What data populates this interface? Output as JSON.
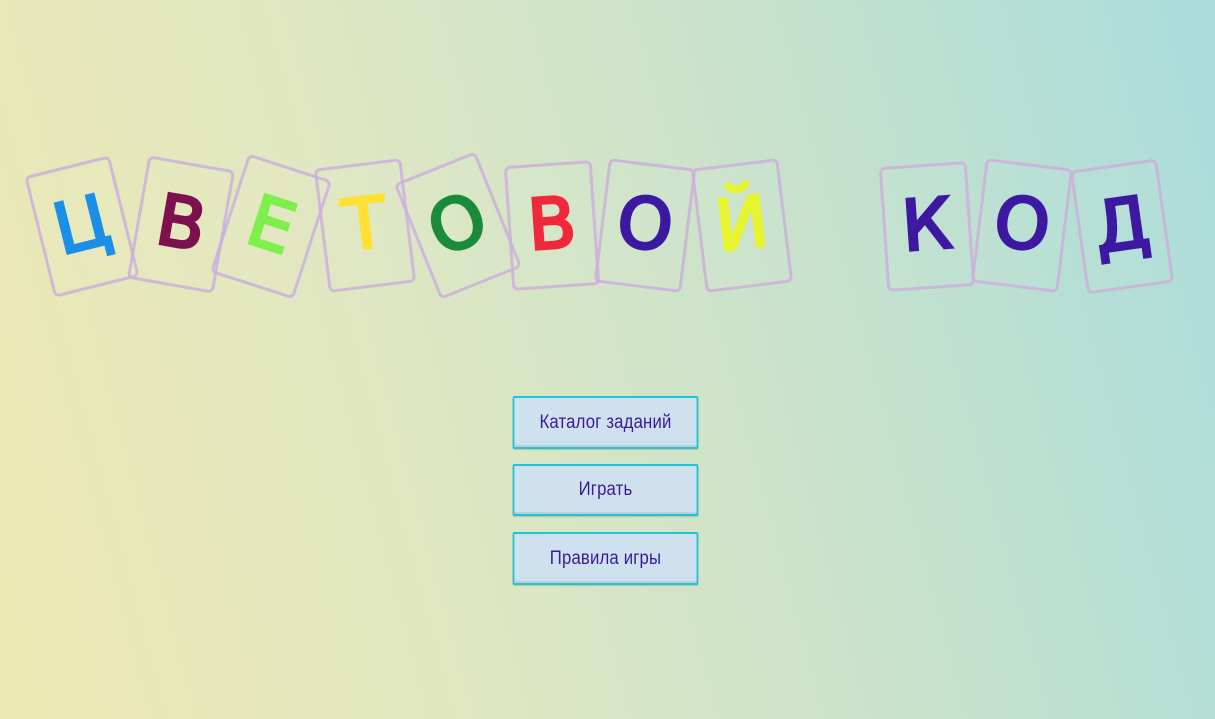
{
  "title": {
    "letters": [
      {
        "char": "ц",
        "color": "#1b8fe8"
      },
      {
        "char": "в",
        "color": "#7d1150"
      },
      {
        "char": "е",
        "color": "#7ff04b"
      },
      {
        "char": "т",
        "color": "#ffe035"
      },
      {
        "char": "о",
        "color": "#1a8a3b"
      },
      {
        "char": "в",
        "color": "#f0283c"
      },
      {
        "char": "о",
        "color": "#3d18a0"
      },
      {
        "char": "й",
        "color": "#e6f52e"
      },
      {
        "char": "к",
        "color": "#3d18a0"
      },
      {
        "char": "о",
        "color": "#3d18a0"
      },
      {
        "char": "д",
        "color": "#3d18a0"
      }
    ]
  },
  "menu": {
    "catalog_label": "Каталог заданий",
    "play_label": "Играть",
    "rules_label": "Правила игры"
  }
}
